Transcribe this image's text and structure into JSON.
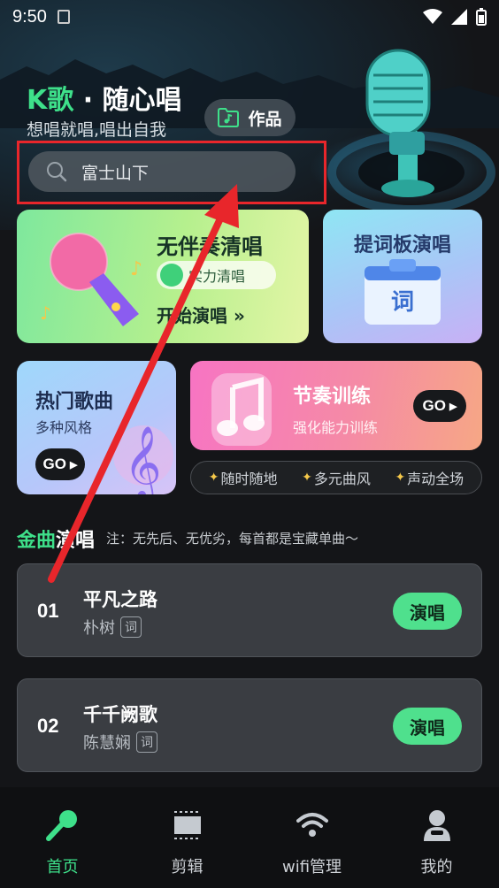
{
  "status_bar": {
    "time": "9:50"
  },
  "header": {
    "app_title_k": "K歌",
    "app_title_rest": " · 随心唱",
    "subtitle": "想唱就唱,唱出自我",
    "works_label": "作品"
  },
  "search": {
    "value": "富士山下"
  },
  "cards": {
    "acapella": {
      "title": "无伴奏清唱",
      "pill": "实力清唱",
      "start": "开始演唱 »"
    },
    "teleprompter": {
      "title": "提词板演唱",
      "badge": "词"
    },
    "hot_songs": {
      "title": "热门歌曲",
      "sub": "多种风格",
      "go": "GO"
    },
    "rhythm": {
      "title": "节奏训练",
      "sub": "强化能力训练",
      "go": "GO"
    }
  },
  "tags": [
    "随时随地",
    "多元曲风",
    "声动全场"
  ],
  "section": {
    "title_green": "金曲",
    "title_rest": "演唱",
    "note": "注：无先后、无优劣，每首都是宝藏单曲～"
  },
  "songs": [
    {
      "no": "01",
      "name": "平凡之路",
      "artist": "朴树",
      "lyric": "词",
      "action": "演唱"
    },
    {
      "no": "02",
      "name": "千千阙歌",
      "artist": "陈慧娴",
      "lyric": "词",
      "action": "演唱"
    }
  ],
  "tabs": [
    {
      "label": "首页",
      "active": true
    },
    {
      "label": "剪辑",
      "active": false
    },
    {
      "label": "wifi管理",
      "active": false
    },
    {
      "label": "我的",
      "active": false
    }
  ],
  "colors": {
    "accent": "#3ee08a",
    "highlight": "#e8262b",
    "background": "#141518"
  }
}
